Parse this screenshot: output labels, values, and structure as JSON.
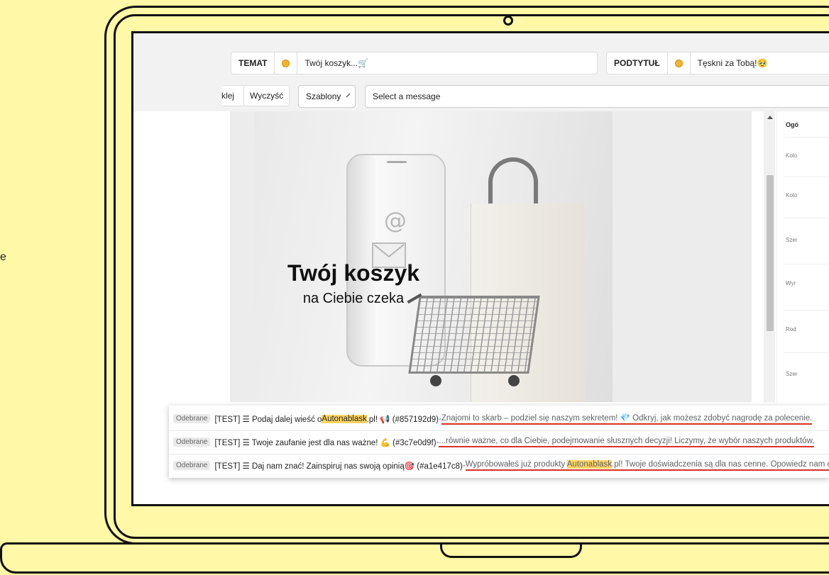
{
  "composer": {
    "subject_label": "TEMAT",
    "subject_value": "Twój koszyk...🛒",
    "subtitle_label": "PODTYTUŁ",
    "subtitle_value": "Tęskni za Tobą!🥹",
    "paste_partial": "klej",
    "clear_label": "Wyczyść",
    "templates_label": "Szablony",
    "message_select_placeholder": "Select a message"
  },
  "hero": {
    "title": "Twój koszyk",
    "subtitle": "na Ciebie czeka",
    "at_symbol": "@"
  },
  "right_panel": {
    "heading": "Ogó",
    "labels": [
      "Kolo",
      "Kolo",
      "Szer",
      "Wyr",
      "Rod",
      "Szer"
    ]
  },
  "side_letter": "e",
  "emails": [
    {
      "badge": "Odebrane",
      "prefix": "[TEST] ☰ Podaj dalej wieść o ",
      "highlight": "Autonablask",
      "after_highlight": ".pl! 📢 (#857192d9)",
      "dash": " - ",
      "snippet": "Znajomi to skarb – podziel się naszym sekretem! 💎 Odkryj, jak możesz zdobyć nagrodę za polecenie.",
      "snippet_highlight": "",
      "snippet_rest": ""
    },
    {
      "badge": "Odebrane",
      "prefix": "[TEST] ☰ Twoje zaufanie jest dla nas ważne! 💪 (#3c7e0d9f)",
      "highlight": "",
      "after_highlight": "",
      "dash": " - ",
      "snippet": "...równie ważne, co dla Ciebie, podejmowanie słusznych decyzji! Liczymy, że wybór naszych produktów,",
      "snippet_highlight": "",
      "snippet_rest": ""
    },
    {
      "badge": "Odebrane",
      "prefix": "[TEST] ☰ Daj nam znać! Zainspiruj nas swoją opinią🎯 (#a1e417c8)",
      "highlight": "",
      "after_highlight": "",
      "dash": " - ",
      "snippet": "Wypróbowałeś już produkty ",
      "snippet_highlight": "Autonablask",
      "snippet_rest": ".pl! Twoje doświadczenia są dla nas cenne. Opowiedz nam o nic"
    }
  ],
  "colors": {
    "background": "#fff8a6",
    "highlight": "#fdd663",
    "underline": "#d93025"
  }
}
